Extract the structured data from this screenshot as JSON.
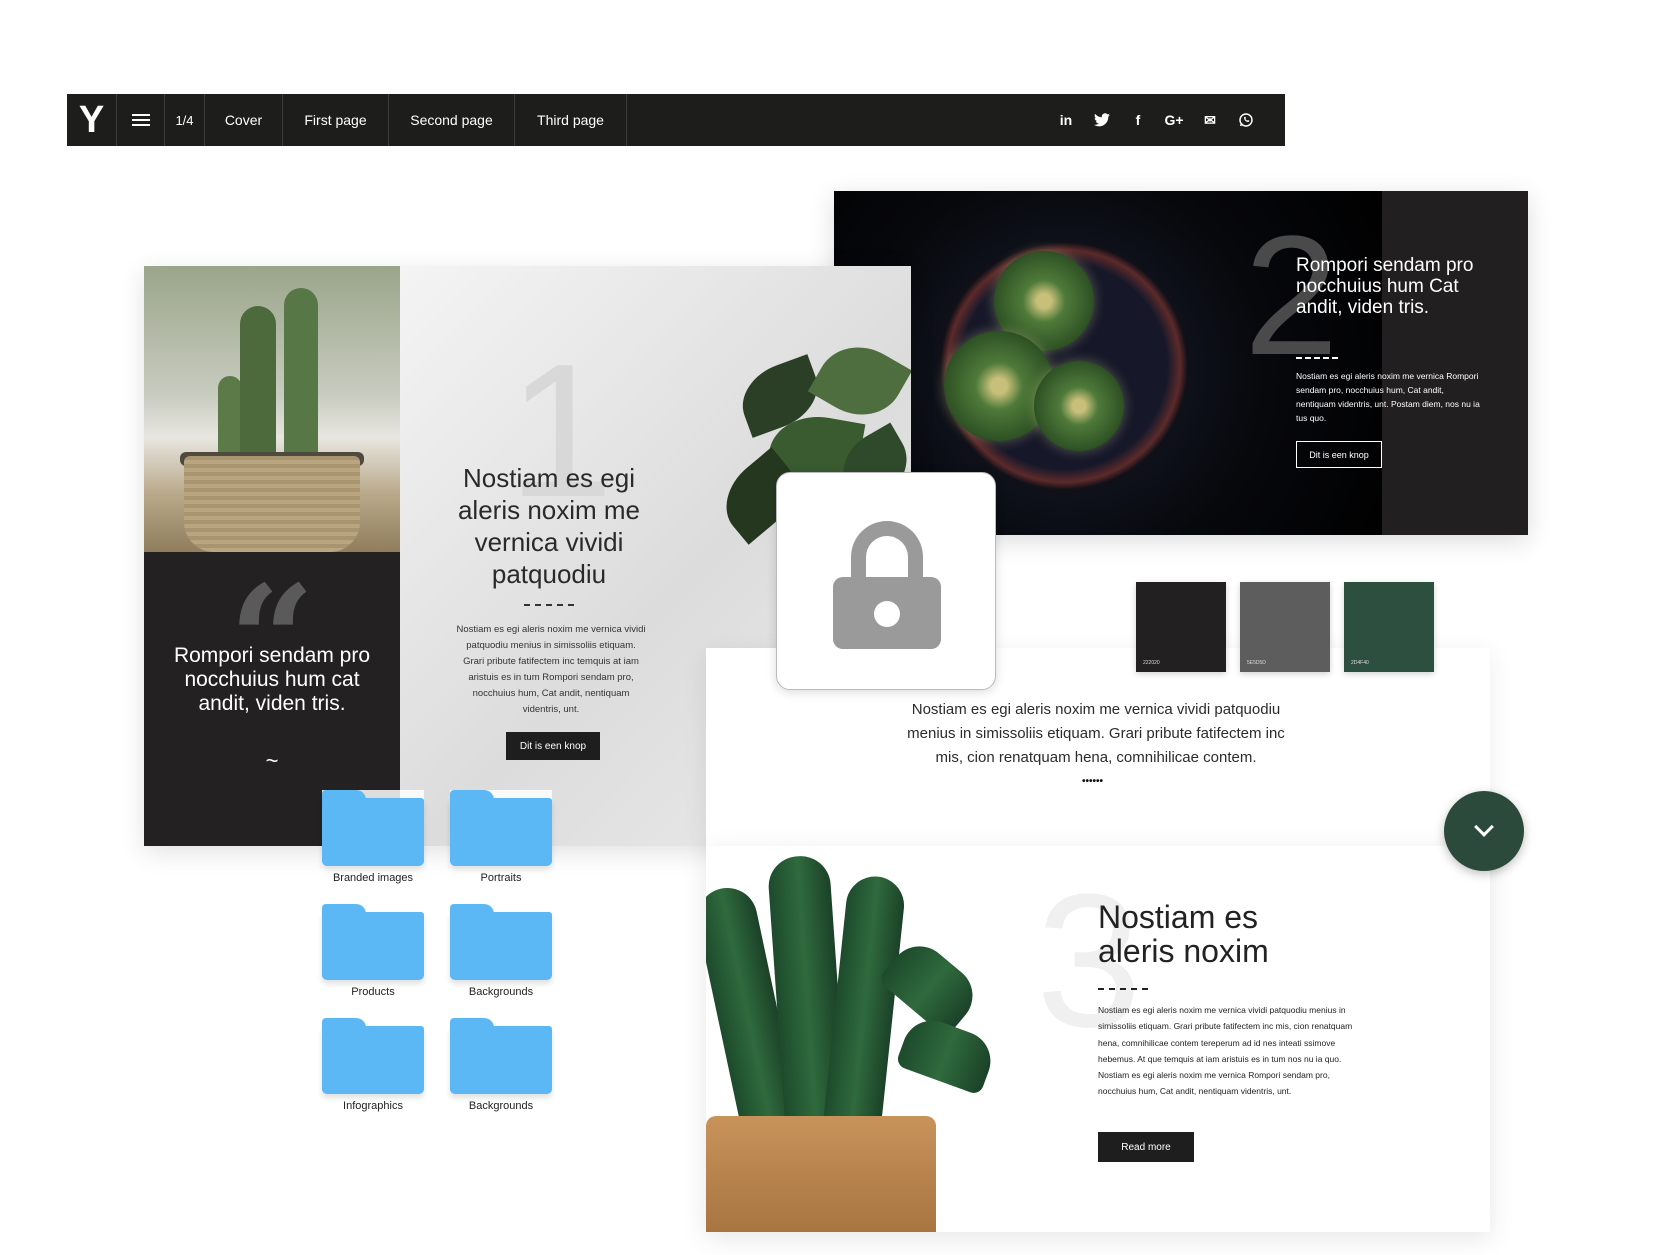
{
  "nav": {
    "logo": "Y",
    "menu_icon": "hamburger-menu-icon",
    "page_count": "1/4",
    "tabs": [
      {
        "label": "Cover"
      },
      {
        "label": "First page"
      },
      {
        "label": "Second page"
      },
      {
        "label": "Third page"
      }
    ],
    "social": [
      {
        "name": "linkedin-icon",
        "glyph": "in"
      },
      {
        "name": "twitter-icon",
        "glyph": "🐦"
      },
      {
        "name": "facebook-icon",
        "glyph": "f"
      },
      {
        "name": "google-plus-icon",
        "glyph": "G+"
      },
      {
        "name": "email-icon",
        "glyph": "✉"
      },
      {
        "name": "whatsapp-icon",
        "glyph": "◯"
      }
    ]
  },
  "card1": {
    "quote_mark": "“",
    "quote": "Rompori sendam pro nocchuius hum cat andit, viden tris.",
    "quote_tilde": "~",
    "number": "1",
    "heading": "Nostiam es egi aleris noxim me vernica vividi patquodiu",
    "body": "Nostiam es egi aleris noxim me vernica vividi patquodiu menius in simissoliis etiquam. Grari pribute fatifectem inc temquis at iam aristuis es in tum Rompori sendam pro, nocchuius hum, Cat andit, nentiquam videntris, unt.",
    "button": "Dit is een knop"
  },
  "card2": {
    "number": "2",
    "heading": "Rompori sendam pro nocchuius hum Cat andit, viden tris.",
    "body": "Nostiam es egi aleris noxim me vernica Rompori sendam pro, nocchuius hum, Cat andit, nentiquam videntris, unt. Postam diem, nos nu ia tus quo.",
    "button": "Dit is een knop"
  },
  "swatches": [
    {
      "label": "222020",
      "color": "#222020"
    },
    {
      "label": "5E5D5D",
      "color": "#5e5d5d"
    },
    {
      "label": "2D4F40",
      "color": "#2d4f40"
    }
  ],
  "card4": {
    "text": "Nostiam es egi aleris noxim me vernica vividi patquodiu menius in simissoliis etiquam. Grari pribute fatifectem inc mis, cion renatquam hena, comnihilicae contem.",
    "dots": "••••••"
  },
  "card3": {
    "number": "3",
    "heading": "Nostiam es aleris noxim",
    "body": "Nostiam es egi aleris noxim me vernica vividi patquodiu menius in simissoliis etiquam. Grari pribute fatifectem inc mis, cion renatquam hena, comnihilicae contem tereperum ad id nes inteati ssimove hebemus. At que temquis at iam aristuis es in tum nos nu ia quo. Nostiam es egi aleris noxim me vernica Rompori sendam pro, nocchuius hum, Cat andit, nentiquam videntris, unt.",
    "button": "Read more"
  },
  "overlay": {
    "lock_icon": "lock-icon",
    "scroll_icon": "chevron-down-icon"
  },
  "folders": [
    {
      "label": "Branded images"
    },
    {
      "label": "Portraits"
    },
    {
      "label": "Products"
    },
    {
      "label": "Backgrounds"
    },
    {
      "label": "Infographics"
    },
    {
      "label": "Backgrounds"
    }
  ],
  "colors": {
    "nav_bg": "#1d1d1b",
    "dark": "#222020",
    "gray": "#5e5d5d",
    "green": "#2d4f40",
    "folder_blue": "#5bb8f5",
    "lock_gray": "#9a9a9a"
  }
}
